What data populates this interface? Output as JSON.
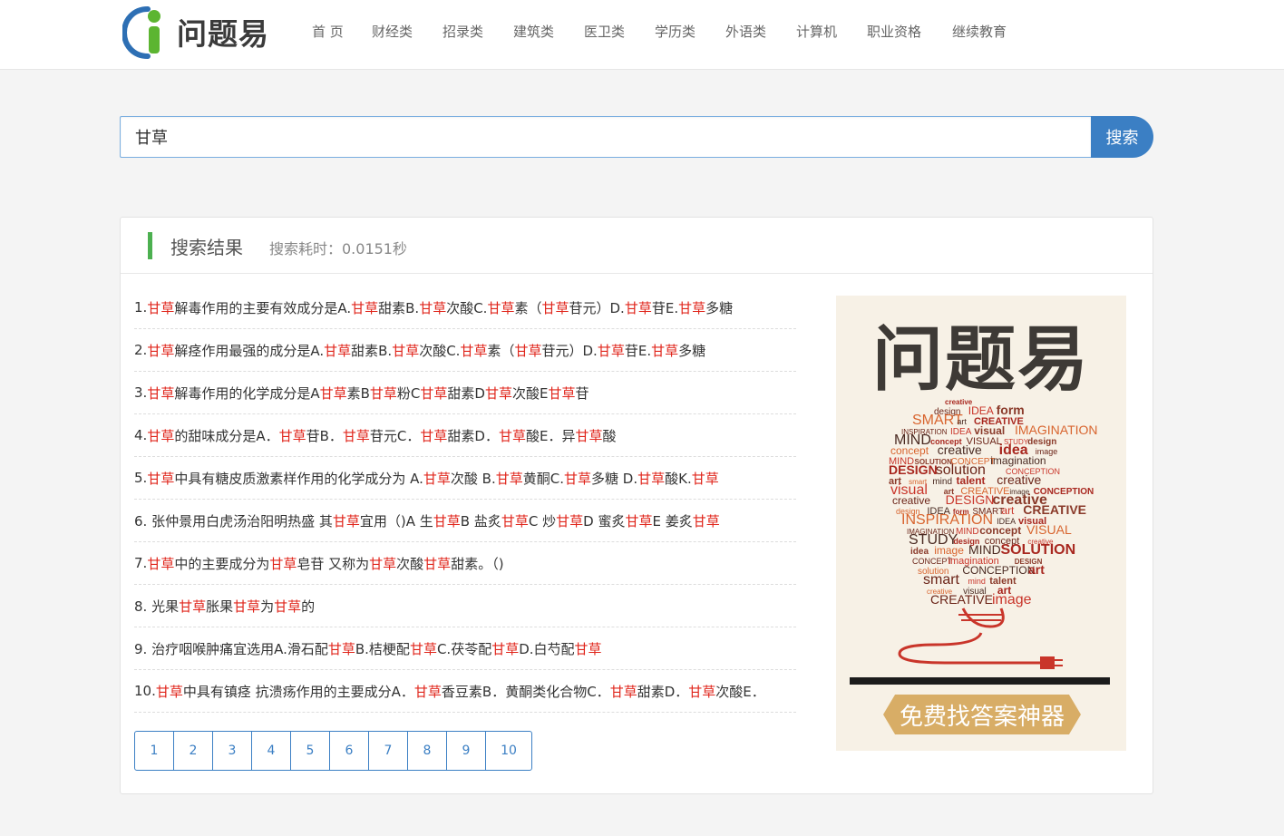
{
  "site": {
    "logo_text": "问题易",
    "nav": [
      "首 页",
      "财经类",
      "招录类",
      "建筑类",
      "医卫类",
      "学历类",
      "外语类",
      "计算机",
      "职业资格",
      "继续教育"
    ]
  },
  "search": {
    "query": "甘草",
    "button_label": "搜索"
  },
  "results_panel": {
    "title": "搜索结果",
    "timing": "搜索耗时：0.0151秒",
    "highlight_term": "甘草",
    "items": [
      "1. 甘草解毒作用的主要有效成分是A.甘草甜素B.甘草次酸C.甘草素（甘草苷元）D.甘草苷E.甘草多糖",
      "2. 甘草解痉作用最强的成分是A.甘草甜素B.甘草次酸C.甘草素（甘草苷元）D.甘草苷E.甘草多糖",
      "3. 甘草解毒作用的化学成分是A 甘草素B 甘草粉C 甘草甜素D 甘草次酸E 甘草苷",
      "4. 甘草的甜味成分是A．甘草苷B．甘草苷元C．甘草甜素D．甘草酸E．异甘草酸",
      "5. 甘草中具有糖皮质激素样作用的化学成分为 A.甘草次酸 B.甘草黄酮C.甘草多糖 D.甘草酸K.甘草",
      "6. 张仲景用白虎汤治阳明热盛 其甘草宜用（)A 生甘草B 盐炙甘草C 炒甘草D 蜜炙甘草E 姜炙甘草",
      "7. 甘草中的主要成分为甘草皂苷 又称为甘草次酸 甘草甜素。（)",
      "8. 光果甘草 胀果甘草为甘草的",
      "9. 治疗咽喉肿痛宜选用A.滑石配甘草B.桔梗配甘草C.茯苓配甘草D.白芍配甘草",
      "10. 甘草中具有镇痉 抗溃疡作用的主要成分A．甘草香豆素B．黄酮类化合物C．甘草甜素D．甘草次酸E．"
    ],
    "pages": [
      "1",
      "2",
      "3",
      "4",
      "5",
      "6",
      "7",
      "8",
      "9",
      "10"
    ]
  },
  "ad": {
    "title": "问题易",
    "slogan": "免费找答案神器",
    "words": [
      "creative",
      "design",
      "IDEA",
      "form",
      "SMART",
      "art",
      "CREATIVE",
      "INSPIRATION",
      "IDEA",
      "visual",
      "IMAGINATION",
      "MIND",
      "concept",
      "VISUAL",
      "STUDY",
      "design",
      "concept",
      "creative",
      "idea",
      "image",
      "MIND",
      "SOLUTION",
      "CONCEPT",
      "imagination",
      "DESIGN",
      "solution",
      "CONCEPTION",
      "art",
      "smart",
      "mind",
      "talent",
      "creative",
      "visual",
      "art",
      "CREATIVE",
      "image",
      "CONCEPTION",
      "creative",
      "DESIGN"
    ]
  },
  "colors": {
    "highlight": "#e0251b",
    "accent": "#3b7fc4",
    "marker": "#4cb050"
  }
}
